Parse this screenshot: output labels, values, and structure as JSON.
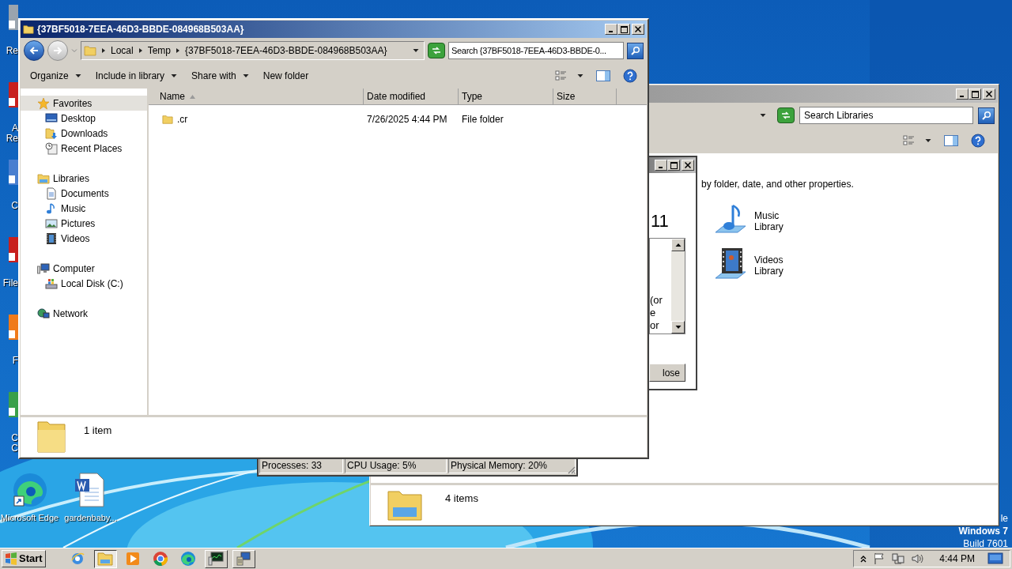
{
  "desktop": {
    "edge_labels": [
      {
        "lines": [
          "Re"
        ]
      },
      {
        "lines": [
          "A",
          "Re"
        ]
      },
      {
        "lines": [
          "C"
        ]
      },
      {
        "lines": [
          "File"
        ]
      },
      {
        "lines": [
          "F"
        ]
      },
      {
        "lines": [
          "C",
          "C"
        ]
      }
    ],
    "icons": [
      {
        "kind": "browser",
        "label": "Microsoft Edge"
      },
      {
        "kind": "document",
        "label": "gardenbaby..."
      }
    ],
    "os_notice": [
      "le",
      "Windows 7",
      "Build 7601"
    ]
  },
  "libraries_window": {
    "active": false,
    "search": {
      "placeholder": "Search Libraries"
    },
    "description": "by folder, date, and other properties.",
    "items": [
      {
        "kind": "music",
        "label": [
          "Music",
          "Library"
        ]
      },
      {
        "kind": "videos",
        "label": [
          "Videos",
          "Library"
        ]
      }
    ],
    "status": "4 items"
  },
  "task_manager": {
    "status": [
      "Processes: 33",
      "CPU Usage: 5%",
      "Physical Memory: 20%"
    ]
  },
  "dialog": {
    "active": false,
    "heading": "11",
    "lines": [
      "(or",
      "e",
      "or"
    ],
    "button": "lose"
  },
  "explorer": {
    "active": true,
    "title": "{37BF5018-7EEA-46D3-BBDE-084968B503AA}",
    "breadcrumb": [
      "Local",
      "Temp",
      "{37BF5018-7EEA-46D3-BBDE-084968B503AA}"
    ],
    "search": {
      "placeholder": "Search {37BF5018-7EEA-46D3-BBDE-0..."
    },
    "toolbar": [
      {
        "label": "Organize",
        "menu": true
      },
      {
        "label": "Include in library",
        "menu": true
      },
      {
        "label": "Share with",
        "menu": true
      },
      {
        "label": "New folder",
        "menu": false
      }
    ],
    "nav": [
      {
        "label": "Favorites",
        "kind": "favorites",
        "selected": true,
        "children": [
          {
            "label": "Desktop",
            "kind": "desktop",
            "selected": false
          },
          {
            "label": "Downloads",
            "kind": "downloads",
            "selected": false
          },
          {
            "label": "Recent Places",
            "kind": "recent",
            "selected": false
          }
        ]
      },
      {
        "label": "Libraries",
        "kind": "libraries",
        "selected": false,
        "children": [
          {
            "label": "Documents",
            "kind": "documents",
            "selected": false
          },
          {
            "label": "Music",
            "kind": "music",
            "selected": false
          },
          {
            "label": "Pictures",
            "kind": "pictures",
            "selected": false
          },
          {
            "label": "Videos",
            "kind": "videos",
            "selected": false
          }
        ]
      },
      {
        "label": "Computer",
        "kind": "computer",
        "selected": false,
        "children": [
          {
            "label": "Local Disk (C:)",
            "kind": "disk",
            "selected": false
          }
        ]
      },
      {
        "label": "Network",
        "kind": "network",
        "selected": false
      }
    ],
    "columns": [
      {
        "label": "Name",
        "sorted": true
      },
      {
        "label": "Date modified",
        "sorted": false
      },
      {
        "label": "Type",
        "sorted": false
      },
      {
        "label": "Size",
        "sorted": false
      }
    ],
    "rows": [
      {
        "name": ".cr",
        "date": "7/26/2025 4:44 PM",
        "type": "File folder"
      }
    ],
    "status": "1 item"
  },
  "taskbar": {
    "start": "Start",
    "buttons": [
      {
        "kind": "ie",
        "open": false,
        "selected": false
      },
      {
        "kind": "explorer",
        "open": true,
        "selected": true
      },
      {
        "kind": "media",
        "open": false,
        "selected": false
      },
      {
        "kind": "chrome",
        "open": false,
        "selected": false
      },
      {
        "kind": "edge",
        "open": false,
        "selected": false
      },
      {
        "kind": "taskmgr",
        "open": true,
        "selected": false
      },
      {
        "kind": "app",
        "open": true,
        "selected": false
      }
    ],
    "clock": "4:44 PM"
  }
}
